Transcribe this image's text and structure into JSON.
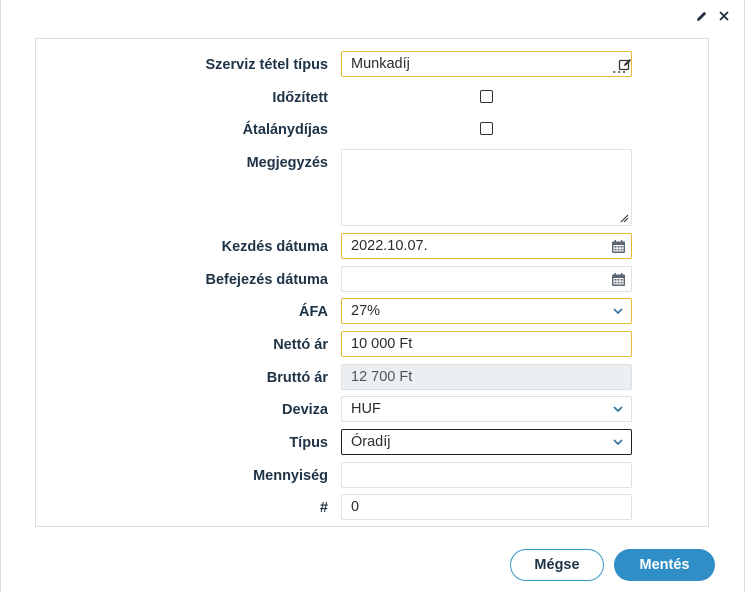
{
  "form": {
    "service_item_type": {
      "label": "Szerviz tétel típus",
      "value": "Munkadíj",
      "dots": "..."
    },
    "scheduled": {
      "label": "Időzített",
      "checked": false
    },
    "flat_fee": {
      "label": "Átalánydíjas",
      "checked": false
    },
    "note": {
      "label": "Megjegyzés",
      "value": ""
    },
    "start_date": {
      "label": "Kezdés dátuma",
      "value": "2022.10.07."
    },
    "end_date": {
      "label": "Befejezés dátuma",
      "value": ""
    },
    "vat": {
      "label": "ÁFA",
      "value": "27%"
    },
    "net_price": {
      "label": "Nettó ár",
      "value": "10 000 Ft"
    },
    "gross_price": {
      "label": "Bruttó ár",
      "value": "12 700 Ft"
    },
    "currency": {
      "label": "Deviza",
      "value": "HUF"
    },
    "type": {
      "label": "Típus",
      "value": "Óradíj"
    },
    "quantity": {
      "label": "Mennyiség",
      "value": ""
    },
    "number": {
      "label": "#",
      "value": "0"
    }
  },
  "buttons": {
    "cancel": "Mégse",
    "save": "Mentés"
  },
  "icons": {
    "header": [
      "pencil-icon",
      "close-icon"
    ],
    "lookup_edit": "edit-icon",
    "date": "calendar-icon",
    "select": "chevron-down-icon"
  },
  "colors": {
    "accent": "#2f8ec6",
    "focus_border": "#e8b83a",
    "label_text": "#1f3347",
    "readonly_bg": "#eceff1"
  }
}
